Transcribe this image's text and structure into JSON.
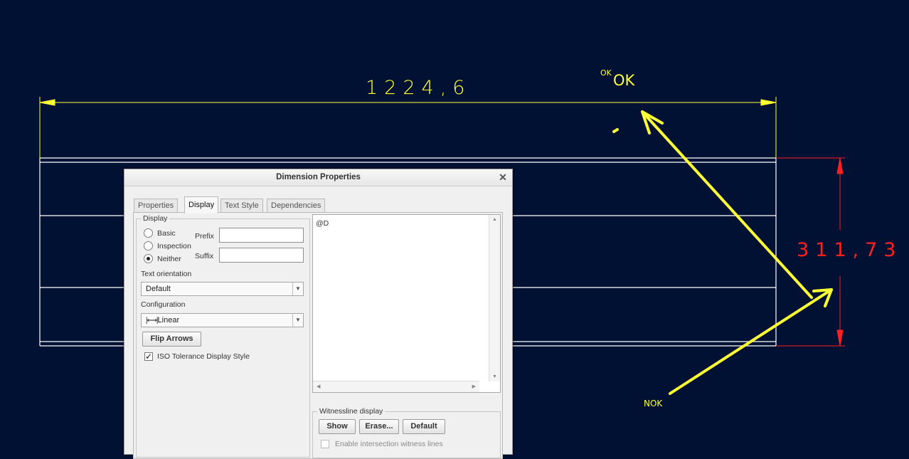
{
  "drawing": {
    "dimension_horizontal": "1224,6",
    "dimension_vertical": "311,73",
    "annotation_ok_small": "OK",
    "annotation_ok_large": "OK",
    "annotation_nok": "NOK",
    "colors": {
      "background": "#001133",
      "geometry": "#ffffff",
      "dimension_yellow": "#ffff33",
      "dimension_red": "#ff2020"
    }
  },
  "dialog": {
    "title": "Dimension Properties",
    "close_icon": "close-icon",
    "tabs": [
      {
        "label": "Properties",
        "active": false
      },
      {
        "label": "Display",
        "active": true
      },
      {
        "label": "Text Style",
        "active": false
      },
      {
        "label": "Dependencies",
        "active": false
      }
    ],
    "display_group": {
      "legend": "Display",
      "options": [
        "Basic",
        "Inspection",
        "Neither"
      ],
      "selected": "Neither",
      "prefix_label": "Prefix",
      "prefix_value": "",
      "suffix_label": "Suffix",
      "suffix_value": ""
    },
    "text_orientation": {
      "label": "Text orientation",
      "value": "Default"
    },
    "configuration": {
      "label": "Configuration",
      "value": "Linear",
      "icon": "linear-dimension-icon"
    },
    "flip_arrows_label": "Flip Arrows",
    "iso_tolerance": {
      "label": "ISO Tolerance Display Style",
      "checked": true
    },
    "dimension_text": "@D",
    "witnessline": {
      "legend": "Witnessline display",
      "show_label": "Show",
      "erase_label": "Erase...",
      "default_label": "Default",
      "intersection_label": "Enable intersection witness lines",
      "intersection_checked": false
    }
  }
}
